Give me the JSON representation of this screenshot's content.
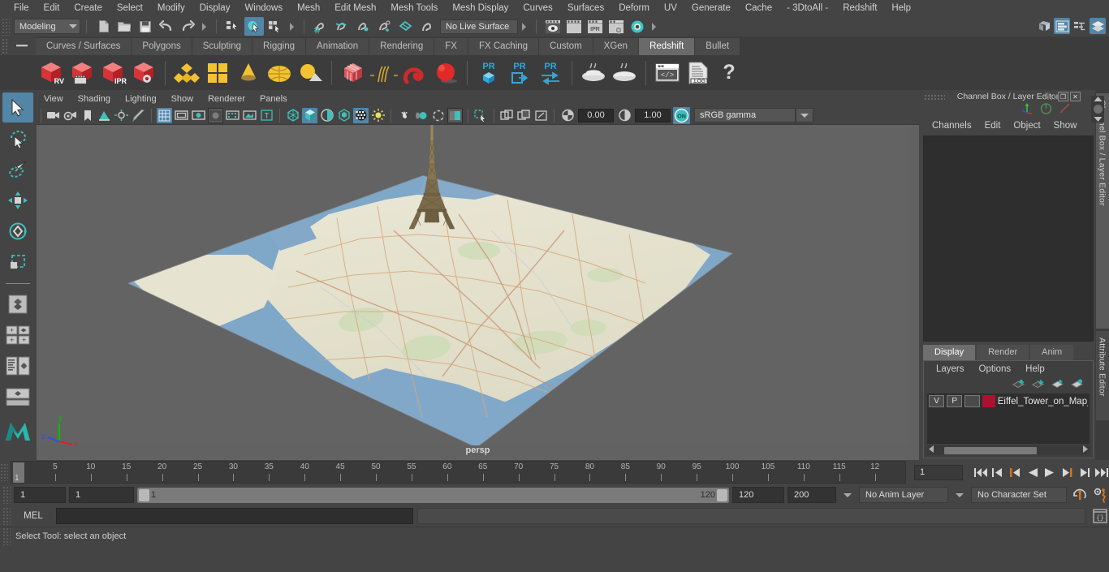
{
  "menubar": {
    "items": [
      "File",
      "Edit",
      "Create",
      "Select",
      "Modify",
      "Display",
      "Windows",
      "Mesh",
      "Edit Mesh",
      "Mesh Tools",
      "Mesh Display",
      "Curves",
      "Surfaces",
      "Deform",
      "UV",
      "Generate",
      "Cache",
      "- 3DtoAll -",
      "Redshift",
      "Help"
    ]
  },
  "statusline": {
    "menu_set": "Modeling",
    "live_surface": "No Live Surface",
    "icons": [
      "new-scene-icon",
      "open-scene-icon",
      "save-scene-icon",
      "undo-icon",
      "redo-icon",
      "select-by-hierarchy-icon",
      "select-by-object-icon",
      "select-by-component-icon",
      "snap-to-grid-icon",
      "snap-to-curve-icon",
      "snap-to-point-icon",
      "snap-to-projected-center-icon",
      "snap-to-view-plane-icon",
      "make-live-icon",
      "render-view-icon",
      "render-current-frame-icon",
      "ipr-render-icon",
      "render-settings-icon",
      "hypershade-icon"
    ],
    "right_icons": [
      "show-hide-modeling-toolkit-icon",
      "show-hide-attribute-editor-icon",
      "show-hide-tool-settings-icon",
      "show-hide-channel-box-icon"
    ]
  },
  "shelf": {
    "tabs": [
      "Curves / Surfaces",
      "Polygons",
      "Sculpting",
      "Rigging",
      "Animation",
      "Rendering",
      "FX",
      "FX Caching",
      "Custom",
      "XGen",
      "Redshift",
      "Bullet"
    ],
    "active_tab": "Redshift",
    "buttons": [
      {
        "name": "redshift-render-view",
        "label": "RV"
      },
      {
        "name": "redshift-render-sequence",
        "label": ""
      },
      {
        "name": "redshift-ipr-render",
        "label": "IPR"
      },
      {
        "name": "redshift-render-settings",
        "label": ""
      },
      {
        "name": "redshift-material-icon",
        "label": ""
      },
      {
        "name": "redshift-texture-icon",
        "label": ""
      },
      {
        "name": "redshift-light-cone-icon",
        "label": ""
      },
      {
        "name": "redshift-dome-light-icon",
        "label": ""
      },
      {
        "name": "redshift-physical-sun-icon",
        "label": ""
      },
      {
        "name": "redshift-proxy-cube-icon",
        "label": ""
      },
      {
        "name": "redshift-hair-icon",
        "label": ""
      },
      {
        "name": "redshift-volume-icon",
        "label": ""
      },
      {
        "name": "redshift-sphere-icon",
        "label": ""
      },
      {
        "name": "redshift-pr-proxy-icon",
        "label": "PR"
      },
      {
        "name": "redshift-pr-export-icon",
        "label": "PR"
      },
      {
        "name": "redshift-pr-transfer-icon",
        "label": "PR"
      },
      {
        "name": "redshift-bake-icon",
        "label": ""
      },
      {
        "name": "redshift-bake-all-icon",
        "label": ""
      },
      {
        "name": "redshift-script-editor-icon",
        "label": ""
      },
      {
        "name": "redshift-log-icon",
        "label": ".LOG"
      },
      {
        "name": "redshift-help-icon",
        "label": "?"
      }
    ]
  },
  "toolbox": {
    "tools": [
      "select-tool",
      "lasso-select-tool",
      "paint-select-tool",
      "move-tool",
      "rotate-tool",
      "scale-tool",
      "last-tool-used",
      "single-perspective-view-layout",
      "four-view-layout",
      "outliner-persp-layout",
      "hypershade-persp-layout",
      "maya-logo-icon"
    ],
    "selected": "select-tool"
  },
  "viewport": {
    "menus": [
      "View",
      "Shading",
      "Lighting",
      "Show",
      "Renderer",
      "Panels"
    ],
    "exposure_value": "0.00",
    "gamma_value": "1.00",
    "color_management": "sRGB gamma",
    "camera_label": "persp",
    "axis_labels": {
      "x": "x",
      "y": "y",
      "z": "z"
    },
    "scene": {
      "object": "Eiffel Tower on map plane"
    },
    "toolbar_icons": [
      "select-camera-icon",
      "camera-attributes-icon",
      "bookmark-icon",
      "image-plane-icon",
      "two-d-pan-zoom-icon",
      "grease-pencil-icon",
      "grid-icon",
      "film-gate-icon",
      "resolution-gate-icon",
      "gate-mask-icon",
      "film-origin-icon",
      "safe-action-icon",
      "hud-text-icon",
      "wireframe-icon",
      "smooth-shade-all-icon",
      "shaded-wireframe-icon",
      "textured-icon",
      "use-all-lights-icon",
      "shadows-icon",
      "ambient-occlusion-icon",
      "motion-blur-icon",
      "multisample-icon",
      "depth-of-field-icon",
      "isolate-select-icon",
      "xray-icon",
      "xray-joints-icon",
      "xray-active-components-icon",
      "exposure-icon",
      "gamma-icon",
      "color-management-toggle-icon"
    ]
  },
  "channel_box": {
    "title": "Channel Box / Layer Editor",
    "menus": [
      "Channels",
      "Edit",
      "Object",
      "Show"
    ],
    "close_glyph": "✕",
    "restore_glyph": "❐"
  },
  "layer_editor": {
    "tabs": [
      "Display",
      "Render",
      "Anim"
    ],
    "active_tab": "Display",
    "menus": [
      "Layers",
      "Options",
      "Help"
    ],
    "buttons": [
      "move-layer-up-icon",
      "move-layer-down-icon",
      "create-new-layer-icon",
      "create-layer-from-selected-icon"
    ],
    "layers": [
      {
        "visibility": "V",
        "playback": "P",
        "display_type": "",
        "color": "#b01030",
        "name": "Eiffel_Tower_on_Map_"
      }
    ]
  },
  "side_tabs": [
    "Channel Box / Layer Editor",
    "Attribute Editor"
  ],
  "time_slider": {
    "tick_labels": [
      "5",
      "10",
      "15",
      "20",
      "25",
      "30",
      "35",
      "40",
      "45",
      "50",
      "55",
      "60",
      "65",
      "70",
      "75",
      "80",
      "85",
      "90",
      "95",
      "100",
      "105",
      "110",
      "115",
      "12"
    ],
    "current_frame": "1",
    "frame_field": "1",
    "playback_buttons": [
      "go-to-start-icon",
      "step-back-keyframe-icon",
      "step-back-frame-icon",
      "play-backwards-icon",
      "play-forwards-icon",
      "step-forward-frame-icon",
      "step-forward-keyframe-icon",
      "go-to-end-icon"
    ]
  },
  "range_slider": {
    "start_field": "1",
    "anim_start_field": "1",
    "range_start": "1",
    "range_end": "120",
    "anim_end_field": "120",
    "playback_end_field": "200",
    "anim_layer": "No Anim Layer",
    "character_set": "No Character Set",
    "icons": [
      "auto-keyframe-icon",
      "animation-preferences-icon"
    ]
  },
  "command_line": {
    "language_label": "MEL",
    "input_value": "",
    "result_value": "",
    "script_editor_icon": "script-editor-icon"
  },
  "help_line": {
    "text": "Select Tool: select an object"
  }
}
